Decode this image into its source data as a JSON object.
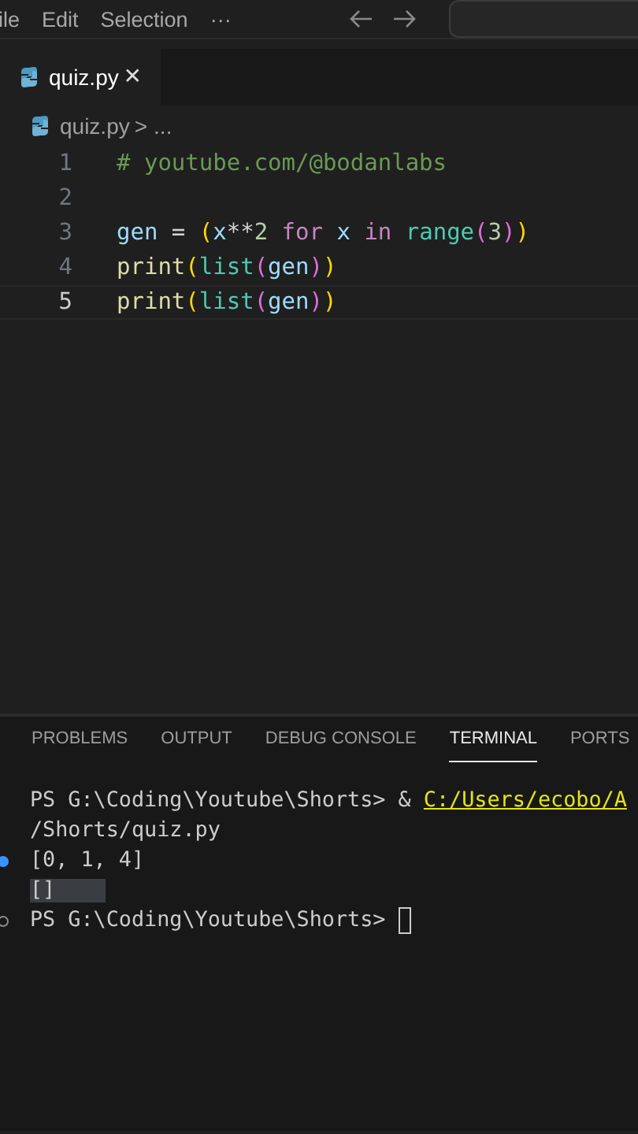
{
  "menu_bar": {
    "items": [
      "ile",
      "Edit",
      "Selection",
      "···"
    ]
  },
  "tabs": [
    {
      "label": "quiz.py",
      "selected": true,
      "close": "✕"
    }
  ],
  "breadcrumb": {
    "file": "quiz.py",
    "separator": ">",
    "rest": "..."
  },
  "editor": {
    "lines": [
      {
        "number": "1",
        "current": false,
        "tokens": [
          {
            "text": "# youtube.com/@bodanlabs",
            "kind": "comment"
          }
        ]
      },
      {
        "number": "2",
        "current": false
      },
      {
        "number": "3",
        "current": false,
        "tokens": [
          {
            "text": "gen",
            "kind": "variable"
          },
          {
            "text": " = ",
            "kind": "operator"
          },
          {
            "text": "(",
            "kind": "bracket1"
          },
          {
            "text": "x",
            "kind": "variable"
          },
          {
            "text": "**",
            "kind": "operator"
          },
          {
            "text": "2",
            "kind": "number"
          },
          {
            "text": " for ",
            "kind": "keyword"
          },
          {
            "text": "x",
            "kind": "variable"
          },
          {
            "text": " in ",
            "kind": "keyword"
          },
          {
            "text": "range",
            "kind": "builtin"
          },
          {
            "text": "(",
            "kind": "bracket2"
          },
          {
            "text": "3",
            "kind": "number"
          },
          {
            "text": ")",
            "kind": "bracket2"
          },
          {
            "text": ")",
            "kind": "bracket1"
          }
        ]
      },
      {
        "number": "4",
        "current": false,
        "tokens": [
          {
            "text": "print",
            "kind": "function"
          },
          {
            "text": "(",
            "kind": "bracket1"
          },
          {
            "text": "list",
            "kind": "builtin"
          },
          {
            "text": "(",
            "kind": "bracket2"
          },
          {
            "text": "gen",
            "kind": "variable"
          },
          {
            "text": ")",
            "kind": "bracket2"
          },
          {
            "text": ")",
            "kind": "bracket1"
          }
        ]
      },
      {
        "number": "5",
        "current": true,
        "tokens": [
          {
            "text": "print",
            "kind": "function"
          },
          {
            "text": "(",
            "kind": "bracket1"
          },
          {
            "text": "list",
            "kind": "builtin"
          },
          {
            "text": "(",
            "kind": "bracket2"
          },
          {
            "text": "gen",
            "kind": "variable"
          },
          {
            "text": ")",
            "kind": "bracket2"
          },
          {
            "text": ")",
            "kind": "bracket1"
          }
        ]
      }
    ]
  },
  "panel": {
    "tabs": [
      {
        "label": "PROBLEMS",
        "selected": false
      },
      {
        "label": "OUTPUT",
        "selected": false
      },
      {
        "label": "DEBUG CONSOLE",
        "selected": false
      },
      {
        "label": "TERMINAL",
        "selected": true
      },
      {
        "label": "PORTS",
        "selected": false
      }
    ],
    "terminal": [
      {
        "success_dot": false,
        "idle_circle": false,
        "selected": false,
        "cursor": false,
        "parts": [
          {
            "text": "PS G:\\Coding\\Youtube\\Shorts> & ",
            "kind": "plain"
          },
          {
            "text": "C:/Users/ecobo/A",
            "kind": "link"
          }
        ]
      },
      {
        "success_dot": false,
        "idle_circle": false,
        "selected": false,
        "cursor": false,
        "parts": [
          {
            "text": "/Shorts/quiz.py",
            "kind": "plain"
          }
        ]
      },
      {
        "success_dot": true,
        "idle_circle": false,
        "selected": false,
        "cursor": false,
        "parts": [
          {
            "text": "[0, 1, 4]",
            "kind": "plain"
          }
        ]
      },
      {
        "success_dot": false,
        "idle_circle": false,
        "selected": true,
        "cursor": false,
        "parts": [
          {
            "text": "[]",
            "kind": "plain"
          }
        ]
      },
      {
        "success_dot": false,
        "idle_circle": true,
        "selected": false,
        "cursor": true,
        "parts": [
          {
            "text": "PS G:\\Coding\\Youtube\\Shorts> ",
            "kind": "plain"
          }
        ]
      }
    ]
  }
}
